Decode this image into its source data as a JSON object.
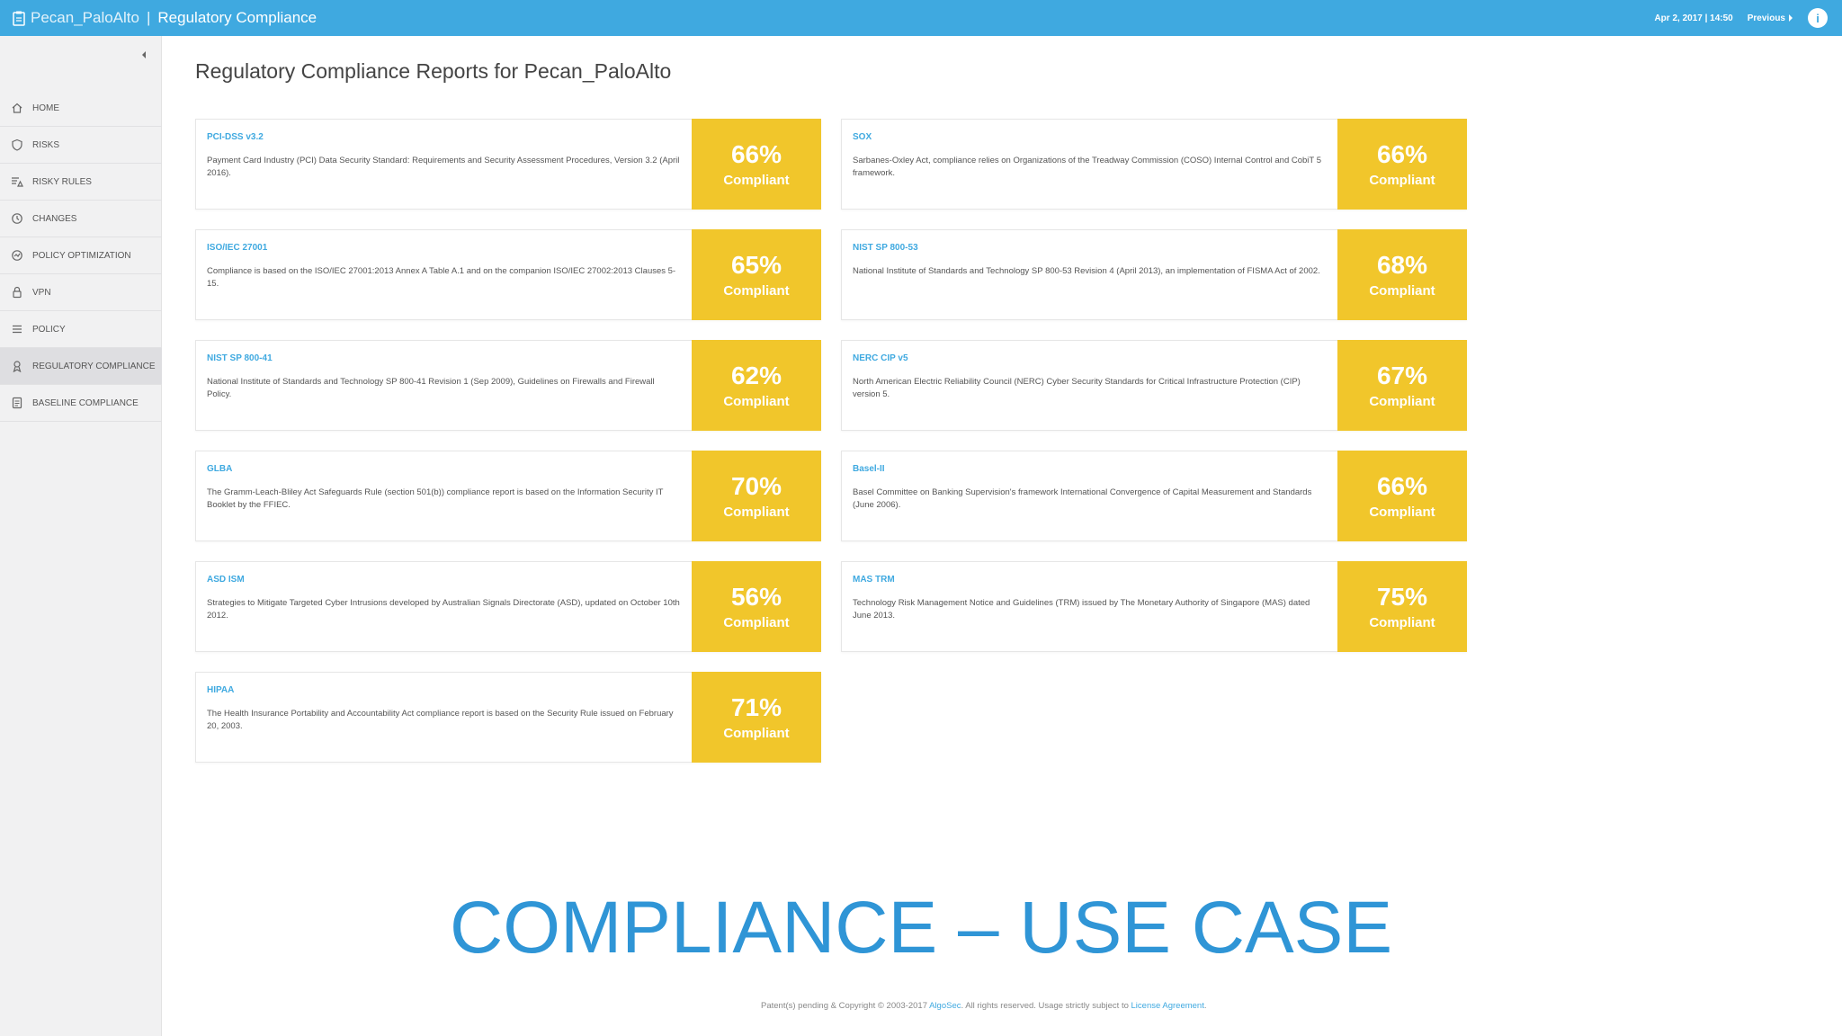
{
  "topbar": {
    "site": "Pecan_PaloAlto",
    "separator": "|",
    "section": "Regulatory Compliance",
    "datetime": "Apr 2, 2017 | 14:50",
    "previous_label": "Previous",
    "info_label": "i",
    "icon": "document-icon",
    "bg_color": "#3fa9e0"
  },
  "sidebar": {
    "items": [
      {
        "label": "HOME",
        "icon": "home-icon"
      },
      {
        "label": "RISKS",
        "icon": "shield-icon"
      },
      {
        "label": "RISKY RULES",
        "icon": "risky-rules-icon"
      },
      {
        "label": "CHANGES",
        "icon": "history-icon"
      },
      {
        "label": "POLICY OPTIMIZATION",
        "icon": "optimization-icon"
      },
      {
        "label": "VPN",
        "icon": "lock-icon"
      },
      {
        "label": "POLICY",
        "icon": "list-icon"
      },
      {
        "label": "REGULATORY COMPLIANCE",
        "icon": "compliance-icon",
        "active": true
      },
      {
        "label": "BASELINE COMPLIANCE",
        "icon": "baseline-icon"
      }
    ]
  },
  "main": {
    "title": "Regulatory Compliance Reports for Pecan_PaloAlto",
    "badge_color": "#f1c62b",
    "reports": [
      {
        "title": "PCI-DSS v3.2",
        "desc": "Payment Card Industry (PCI) Data Security Standard: Requirements and Security Assessment Procedures, Version 3.2 (April 2016).",
        "percent": "66%",
        "status": "Compliant"
      },
      {
        "title": "SOX",
        "desc": "Sarbanes-Oxley Act, compliance relies on Organizations of the Treadway Commission (COSO) Internal Control and CobiT 5 framework.",
        "percent": "66%",
        "status": "Compliant"
      },
      {
        "title": "ISO/IEC 27001",
        "desc": "Compliance is based on the ISO/IEC 27001:2013 Annex A Table A.1 and on the companion ISO/IEC 27002:2013 Clauses 5-15.",
        "percent": "65%",
        "status": "Compliant"
      },
      {
        "title": "NIST SP 800-53",
        "desc": "National Institute of Standards and Technology SP 800-53 Revision 4 (April 2013), an implementation of FISMA Act of 2002.",
        "percent": "68%",
        "status": "Compliant"
      },
      {
        "title": "NIST SP 800-41",
        "desc": "National Institute of Standards and Technology SP 800-41 Revision 1 (Sep 2009), Guidelines on Firewalls and Firewall Policy.",
        "percent": "62%",
        "status": "Compliant"
      },
      {
        "title": "NERC CIP v5",
        "desc": "North American Electric Reliability Council (NERC) Cyber Security Standards for Critical Infrastructure Protection (CIP) version 5.",
        "percent": "67%",
        "status": "Compliant"
      },
      {
        "title": "GLBA",
        "desc": "The Gramm-Leach-Bliley Act Safeguards Rule (section 501(b)) compliance report is based on the Information Security IT Booklet by the FFIEC.",
        "percent": "70%",
        "status": "Compliant"
      },
      {
        "title": "Basel-II",
        "desc": "Basel Committee on Banking Supervision's framework International Convergence of Capital Measurement and Standards (June 2006).",
        "percent": "66%",
        "status": "Compliant"
      },
      {
        "title": "ASD ISM",
        "desc": "Strategies to Mitigate Targeted Cyber Intrusions developed by Australian Signals Directorate (ASD), updated on October 10th 2012.",
        "percent": "56%",
        "status": "Compliant"
      },
      {
        "title": "MAS TRM",
        "desc": "Technology Risk Management Notice and Guidelines (TRM) issued by The Monetary Authority of Singapore (MAS) dated June 2013.",
        "percent": "75%",
        "status": "Compliant"
      },
      {
        "title": "HIPAA",
        "desc": "The Health Insurance Portability and Accountability Act compliance report is based on the Security Rule issued on February 20, 2003.",
        "percent": "71%",
        "status": "Compliant"
      }
    ]
  },
  "headline": "COMPLIANCE – USE CASE",
  "footer": {
    "prefix": "Patent(s) pending & Copyright © 2003-2017 ",
    "company": "AlgoSec",
    "middle": ". All rights reserved. Usage strictly subject to ",
    "license": "License Agreement",
    "suffix": "."
  }
}
